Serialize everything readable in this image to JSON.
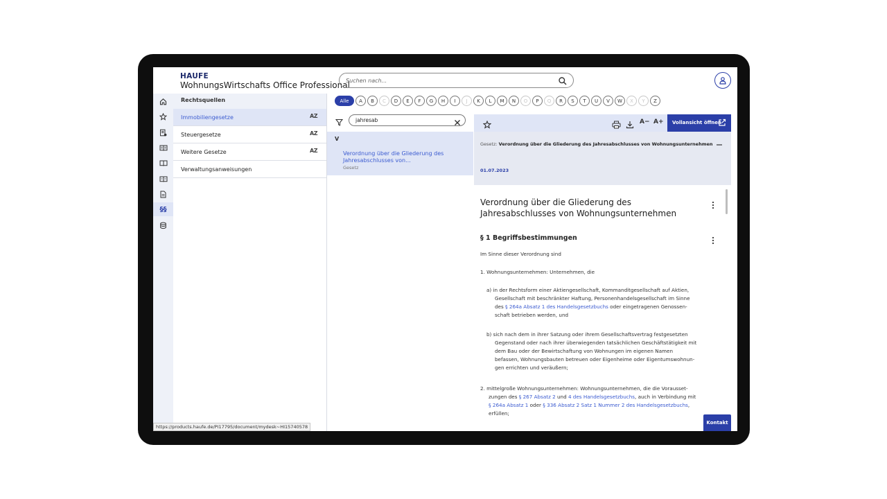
{
  "header": {
    "logo": "HAUFE",
    "product": "WohnungsWirtschafts Office Professional",
    "search_placeholder": "Suchen nach..."
  },
  "sidebar": {
    "title": "Rechtsquellen",
    "items": [
      {
        "label": "Immobiliengesetze",
        "sort": "AZ",
        "active": true
      },
      {
        "label": "Steuergesetze",
        "sort": "AZ"
      },
      {
        "label": "Weitere Gesetze",
        "sort": "AZ"
      },
      {
        "label": "Verwaltungsanweisungen"
      }
    ]
  },
  "alphabet": {
    "all_label": "Alle",
    "letters": [
      "A",
      "B",
      "C",
      "D",
      "E",
      "F",
      "G",
      "H",
      "I",
      "J",
      "K",
      "L",
      "M",
      "N",
      "O",
      "P",
      "Q",
      "R",
      "S",
      "T",
      "U",
      "V",
      "W",
      "X",
      "Y",
      "Z"
    ],
    "disabled": [
      "C",
      "J",
      "O",
      "Q",
      "X",
      "Y"
    ]
  },
  "results": {
    "filter_value": "jahresab",
    "group": "V",
    "items": [
      {
        "title": "Verordnung über die Gliederung des Jahresabschlusses von...",
        "type": "Gesetz"
      }
    ]
  },
  "document": {
    "open_full_label": "Vollansicht öffnen",
    "font_smaller": "A−",
    "font_larger": "A+",
    "meta_prefix": "Gesetz:",
    "meta_title": "Verordnung über die Gliederung des Jahresabschlusses von Wohnungsunternehmen",
    "date": "01.07.2023",
    "title": "Verordnung über die Gliederung des Jahresabschlusses von Wohnungsunternehmen",
    "section": "§ 1 Begriffsbestimmungen",
    "intro": "Im Sinne dieser Verordnung sind",
    "item1": "1. Wohnungsunternehmen: Unternehmen, die",
    "a1": "a)  in der Rechtsform einer Aktiengesellschaft, Kommanditgesellschaft auf Aktien,",
    "a2": "Gesellschaft mit beschränkter Haftung, Personenhandelsgesellschaft im Sinne",
    "a3_pre": "des ",
    "a3_link": "§ 264a Absatz 1 des Handelsgesetzbuchs",
    "a3_post": " oder eingetragenen Genossen-",
    "a4": "schaft betrieben werden, und",
    "b1": "b)  sich nach dem in ihrer Satzung oder ihrem Gesellschaftsvertrag festgesetzten",
    "b2": "Gegenstand oder nach ihrer überwiegenden tatsächlichen Geschäftstätigkeit mit",
    "b3": "dem Bau oder der Bewirtschaftung von Wohnungen im eigenen Namen",
    "b4": "befassen, Wohnungsbauten betreuen oder Eigenheime oder Eigentumswohnun-",
    "b5": "gen errichten und veräußern;",
    "c1": "2. mittelgroße Wohnungsunternehmen: Wohnungsunternehmen, die die Vorausset-",
    "c2_pre": "zungen des ",
    "c2_link1": "§ 267 Absatz 2",
    "c2_mid": " und ",
    "c2_link2": "4 des Handelsgesetzbuchs",
    "c2_post": ", auch in Verbindung mit",
    "c3_link1": "§ 264a Absatz 1",
    "c3_mid": " oder ",
    "c3_link2": "§ 336 Absatz 2 Satz 1 Nummer 2 des Handelsgesetzbuchs",
    "c3_post": ",",
    "c4": "erfüllen;"
  },
  "contact_label": "Kontakt",
  "status_url": "https://products.haufe.de/PI17795/document/mydesk~HI15740578",
  "colors": {
    "accent": "#2b3fa8",
    "selected_bg": "#dfe5f6",
    "link": "#3b5bd0"
  }
}
